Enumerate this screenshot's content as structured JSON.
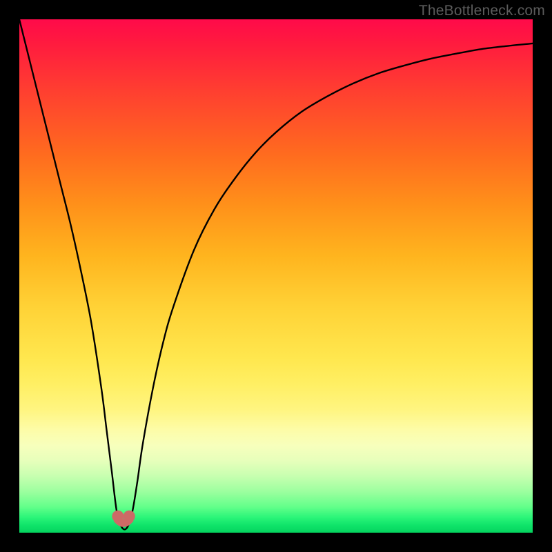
{
  "watermark": "TheBottleneck.com",
  "colors": {
    "frame": "#000000",
    "curve_stroke": "#000000",
    "marker_fill": "#cc6a66",
    "marker_stroke": "#b85a56"
  },
  "chart_data": {
    "type": "line",
    "title": "",
    "xlabel": "",
    "ylabel": "",
    "xlim": [
      0,
      100
    ],
    "ylim": [
      0,
      100
    ],
    "grid": false,
    "legend": false,
    "annotations": [
      "gradient background red→yellow→green top→bottom"
    ],
    "series": [
      {
        "name": "bottleneck-curve",
        "x": [
          0,
          2,
          4,
          6,
          8,
          10,
          12,
          14,
          16,
          17,
          18,
          19,
          20,
          21,
          22,
          23,
          24,
          26,
          28,
          30,
          34,
          38,
          42,
          46,
          50,
          55,
          60,
          65,
          70,
          75,
          80,
          85,
          90,
          95,
          100
        ],
        "y": [
          100,
          92,
          84,
          76,
          68,
          60,
          51,
          41,
          28,
          20,
          12,
          4,
          1,
          1,
          4,
          10,
          17,
          28,
          37,
          44,
          55,
          63,
          69,
          74,
          78,
          82,
          85,
          87.5,
          89.5,
          91,
          92.3,
          93.3,
          94.2,
          94.8,
          95.3
        ]
      }
    ],
    "markers": [
      {
        "x": 19.2,
        "y": 3.2
      },
      {
        "x": 21.4,
        "y": 3.2
      }
    ]
  }
}
